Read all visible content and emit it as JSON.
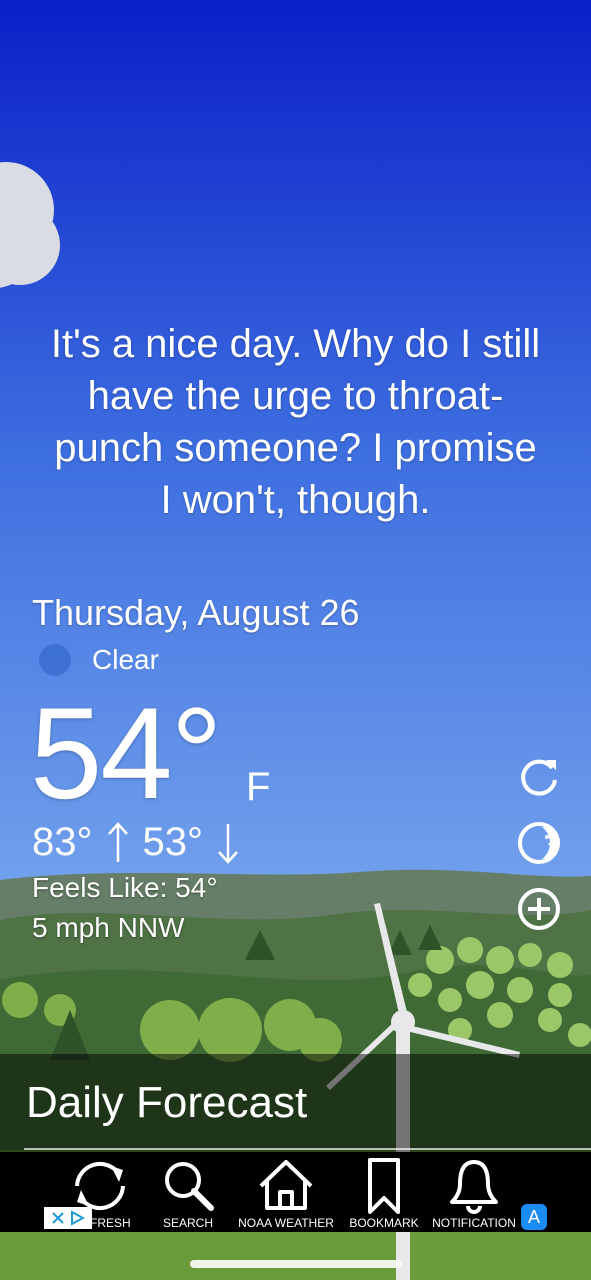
{
  "quote": {
    "lines": [
      "It's a nice day. Why do I still",
      "have the urge to throat-",
      "punch someone? I promise",
      "I won't, though."
    ]
  },
  "weather": {
    "date": "Thursday, August 26",
    "condition": "Clear",
    "condition_icon": "moon-icon",
    "temperature": "54°",
    "unit": "F",
    "high": "83°",
    "low": "53°",
    "feels_like": "Feels Like: 54°",
    "wind": "5 mph NNW"
  },
  "side_buttons": [
    "refresh-icon",
    "moon-phase-icon",
    "add-icon"
  ],
  "forecast": {
    "title": "Daily Forecast"
  },
  "tabs": [
    {
      "label": "FRESH",
      "icon": "refresh-icon"
    },
    {
      "label": "SEARCH",
      "icon": "search-icon"
    },
    {
      "label": "NOAA WEATHER",
      "icon": "home-icon"
    },
    {
      "label": "BOOKMARK",
      "icon": "bookmark-icon"
    },
    {
      "label": "NOTIFICATION",
      "icon": "bell-icon"
    }
  ],
  "colors": {
    "sky_top": "#0a1fc8",
    "sky_bottom": "#7aa9ee",
    "hills": "#4e6e3a",
    "grass": "#5a8b32"
  }
}
